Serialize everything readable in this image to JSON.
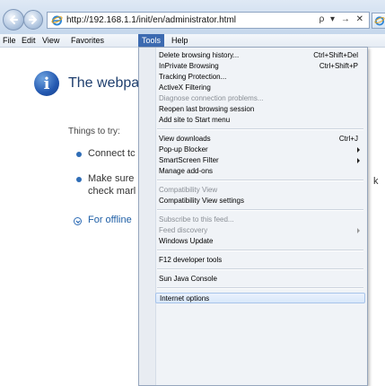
{
  "address": {
    "url": "http://192.168.1.1/init/en/administrator.html",
    "controls": "ρ ▾ → ✕"
  },
  "menubar": {
    "items": [
      "File",
      "Edit",
      "View",
      "Favorites",
      "Tools",
      "Help"
    ],
    "active": "Tools"
  },
  "page": {
    "title": "The webpag",
    "things_to_try": "Things to try:",
    "bullets": [
      "Connect tc",
      "Make sure",
      "check marl"
    ],
    "offline": "For offline",
    "clipped_side_text": "k"
  },
  "tools_menu": {
    "groups": [
      [
        {
          "label": "Delete browsing history...",
          "shortcut": "Ctrl+Shift+Del",
          "disabled": false,
          "submenu": false
        },
        {
          "label": "InPrivate Browsing",
          "shortcut": "Ctrl+Shift+P",
          "disabled": false,
          "submenu": false
        },
        {
          "label": "Tracking Protection...",
          "shortcut": "",
          "disabled": false,
          "submenu": false
        },
        {
          "label": "ActiveX Filtering",
          "shortcut": "",
          "disabled": false,
          "submenu": false
        },
        {
          "label": "Diagnose connection problems...",
          "shortcut": "",
          "disabled": true,
          "submenu": false
        },
        {
          "label": "Reopen last browsing session",
          "shortcut": "",
          "disabled": false,
          "submenu": false
        },
        {
          "label": "Add site to Start menu",
          "shortcut": "",
          "disabled": false,
          "submenu": false
        }
      ],
      [
        {
          "label": "View downloads",
          "shortcut": "Ctrl+J",
          "disabled": false,
          "submenu": false
        },
        {
          "label": "Pop-up Blocker",
          "shortcut": "",
          "disabled": false,
          "submenu": true
        },
        {
          "label": "SmartScreen Filter",
          "shortcut": "",
          "disabled": false,
          "submenu": true
        },
        {
          "label": "Manage add-ons",
          "shortcut": "",
          "disabled": false,
          "submenu": false
        }
      ],
      [
        {
          "label": "Compatibility View",
          "shortcut": "",
          "disabled": true,
          "submenu": false
        },
        {
          "label": "Compatibility View settings",
          "shortcut": "",
          "disabled": false,
          "submenu": false
        }
      ],
      [
        {
          "label": "Subscribe to this feed...",
          "shortcut": "",
          "disabled": true,
          "submenu": false
        },
        {
          "label": "Feed discovery",
          "shortcut": "",
          "disabled": true,
          "submenu": true
        },
        {
          "label": "Windows Update",
          "shortcut": "",
          "disabled": false,
          "submenu": false
        }
      ],
      [
        {
          "label": "F12 developer tools",
          "shortcut": "",
          "disabled": false,
          "submenu": false
        }
      ],
      [
        {
          "label": "Sun Java Console",
          "shortcut": "",
          "disabled": false,
          "submenu": false
        }
      ],
      [
        {
          "label": "Internet options",
          "shortcut": "",
          "disabled": false,
          "submenu": false,
          "highlighted": true
        }
      ]
    ]
  },
  "colors": {
    "menu_active": "#3c6ab0",
    "hover_border": "#a8c4ea",
    "disabled_text": "#8a8f96",
    "link_blue": "#1f5fa6"
  },
  "icons": [
    "back-arrow-icon",
    "forward-arrow-icon",
    "ie-logo-icon",
    "info-icon",
    "bullet-icon",
    "chevron-down-circle-icon",
    "submenu-arrow-icon"
  ]
}
